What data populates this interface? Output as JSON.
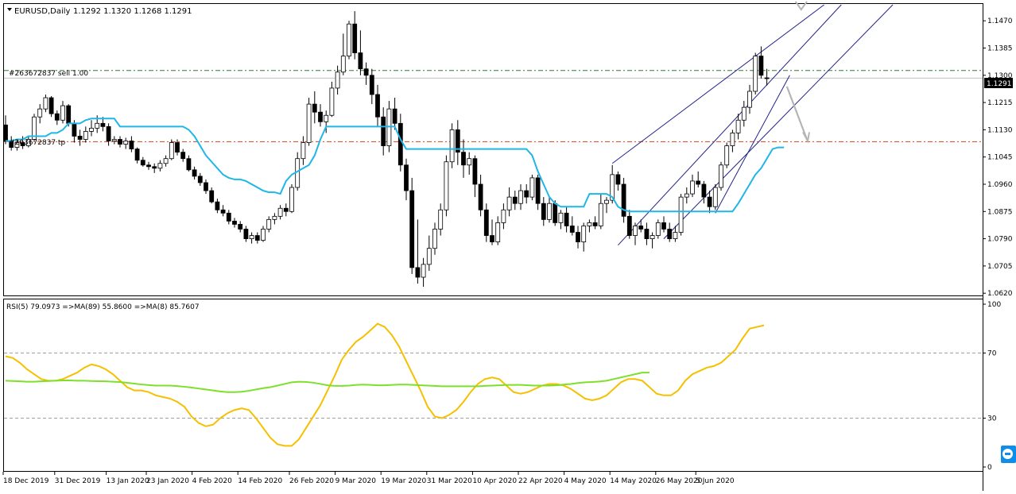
{
  "chart_data": [
    {
      "type": "candlestick",
      "symbol_label": "EURUSD,Daily",
      "ohlc_label": "1.1292 1.1320 1.1268 1.1291",
      "price_axis_ticks": [
        "1.1470",
        "1.1385",
        "1.1300",
        "1.1215",
        "1.1130",
        "1.1045",
        "1.0960",
        "1.0875",
        "1.0790",
        "1.0705",
        "1.0620"
      ],
      "ylim": [
        1.0618,
        1.152
      ],
      "current_price_label": "1.1291",
      "current_price": 1.1291,
      "order_label": "#263672837 sell 1.00",
      "order_price": 1.1315,
      "stop_label": "#263672837 tp",
      "target_price": 1.1093,
      "grid": false,
      "colors": {
        "candle_bull_fill": "#ffffff",
        "candle_bear_fill": "#000000",
        "ma_line": "#1fb6e8",
        "channel": "#23238c",
        "order_line": "#2e7d32",
        "target_line": "#d84315",
        "arrow": "#b5b5b5"
      },
      "candles": [
        [
          1.1145,
          1.1175,
          1.1085,
          1.1095
        ],
        [
          1.1095,
          1.111,
          1.1065,
          1.1075
        ],
        [
          1.1075,
          1.11,
          1.1065,
          1.109
        ],
        [
          1.109,
          1.111,
          1.107,
          1.108
        ],
        [
          1.108,
          1.111,
          1.1075,
          1.11
        ],
        [
          1.11,
          1.118,
          1.1095,
          1.117
        ],
        [
          1.117,
          1.121,
          1.115,
          1.1195
        ],
        [
          1.1195,
          1.124,
          1.1185,
          1.123
        ],
        [
          1.123,
          1.1235,
          1.117,
          1.118
        ],
        [
          1.118,
          1.119,
          1.1145,
          1.116
        ],
        [
          1.116,
          1.122,
          1.115,
          1.1205
        ],
        [
          1.1205,
          1.121,
          1.114,
          1.115
        ],
        [
          1.115,
          1.116,
          1.109,
          1.111
        ],
        [
          1.111,
          1.113,
          1.108,
          1.11
        ],
        [
          1.11,
          1.114,
          1.109,
          1.1125
        ],
        [
          1.1125,
          1.116,
          1.111,
          1.1135
        ],
        [
          1.1135,
          1.1175,
          1.112,
          1.115
        ],
        [
          1.115,
          1.117,
          1.1125,
          1.114
        ],
        [
          1.114,
          1.115,
          1.108,
          1.1095
        ],
        [
          1.1095,
          1.111,
          1.1085,
          1.11
        ],
        [
          1.11,
          1.111,
          1.1075,
          1.1085
        ],
        [
          1.1085,
          1.1105,
          1.107,
          1.1095
        ],
        [
          1.1095,
          1.111,
          1.106,
          1.107
        ],
        [
          1.107,
          1.1075,
          1.1025,
          1.1035
        ],
        [
          1.1035,
          1.1045,
          1.1015,
          1.102
        ],
        [
          1.102,
          1.103,
          1.1005,
          1.1015
        ],
        [
          1.1015,
          1.1025,
          1.0995,
          1.101
        ],
        [
          1.101,
          1.1035,
          1.1,
          1.1025
        ],
        [
          1.1025,
          1.105,
          1.1015,
          1.104
        ],
        [
          1.104,
          1.11,
          1.1035,
          1.109
        ],
        [
          1.109,
          1.11,
          1.105,
          1.106
        ],
        [
          1.106,
          1.107,
          1.103,
          1.104
        ],
        [
          1.104,
          1.105,
          1.1,
          1.1005
        ],
        [
          1.1005,
          1.1015,
          1.0975,
          1.0985
        ],
        [
          1.0985,
          1.0995,
          1.0955,
          1.0965
        ],
        [
          1.0965,
          1.0975,
          1.093,
          1.094
        ],
        [
          1.094,
          1.095,
          1.09,
          1.0905
        ],
        [
          1.0905,
          1.0915,
          1.087,
          1.088
        ],
        [
          1.088,
          1.0895,
          1.086,
          1.087
        ],
        [
          1.087,
          1.088,
          1.0835,
          1.0845
        ],
        [
          1.0845,
          1.0855,
          1.0825,
          1.0835
        ],
        [
          1.0835,
          1.0845,
          1.081,
          1.082
        ],
        [
          1.082,
          1.083,
          1.078,
          1.079
        ],
        [
          1.079,
          1.081,
          1.0775,
          1.08
        ],
        [
          1.08,
          1.081,
          1.0775,
          1.0785
        ],
        [
          1.0785,
          1.083,
          1.078,
          1.082
        ],
        [
          1.082,
          1.086,
          1.081,
          1.085
        ],
        [
          1.085,
          1.087,
          1.0835,
          1.086
        ],
        [
          1.086,
          1.0895,
          1.085,
          1.0885
        ],
        [
          1.0885,
          1.09,
          1.086,
          1.0875
        ],
        [
          1.0875,
          1.096,
          1.087,
          1.095
        ],
        [
          1.095,
          1.106,
          1.094,
          1.104
        ],
        [
          1.104,
          1.111,
          1.102,
          1.109
        ],
        [
          1.109,
          1.123,
          1.108,
          1.121
        ],
        [
          1.121,
          1.125,
          1.115,
          1.1185
        ],
        [
          1.1185,
          1.121,
          1.114,
          1.1155
        ],
        [
          1.1155,
          1.119,
          1.112,
          1.1175
        ],
        [
          1.1175,
          1.128,
          1.117,
          1.126
        ],
        [
          1.126,
          1.133,
          1.124,
          1.131
        ],
        [
          1.131,
          1.143,
          1.13,
          1.136
        ],
        [
          1.136,
          1.147,
          1.135,
          1.146
        ],
        [
          1.146,
          1.15,
          1.135,
          1.137
        ],
        [
          1.137,
          1.144,
          1.13,
          1.132
        ],
        [
          1.132,
          1.134,
          1.127,
          1.13
        ],
        [
          1.13,
          1.132,
          1.121,
          1.124
        ],
        [
          1.124,
          1.127,
          1.114,
          1.117
        ],
        [
          1.117,
          1.12,
          1.105,
          1.108
        ],
        [
          1.108,
          1.122,
          1.106,
          1.1195
        ],
        [
          1.1195,
          1.123,
          1.113,
          1.115
        ],
        [
          1.115,
          1.118,
          1.1,
          1.102
        ],
        [
          1.102,
          1.104,
          1.091,
          1.094
        ],
        [
          1.094,
          1.098,
          1.068,
          1.07
        ],
        [
          1.07,
          1.085,
          1.065,
          1.067
        ],
        [
          1.067,
          1.073,
          1.064,
          1.071
        ],
        [
          1.071,
          1.08,
          1.069,
          1.076
        ],
        [
          1.076,
          1.084,
          1.074,
          1.082
        ],
        [
          1.082,
          1.09,
          1.08,
          1.088
        ],
        [
          1.088,
          1.105,
          1.086,
          1.103
        ],
        [
          1.103,
          1.115,
          1.101,
          1.113
        ],
        [
          1.113,
          1.116,
          1.102,
          1.106
        ],
        [
          1.106,
          1.11,
          1.098,
          1.102
        ],
        [
          1.102,
          1.106,
          1.099,
          1.104
        ],
        [
          1.104,
          1.105,
          1.092,
          1.096
        ],
        [
          1.096,
          1.099,
          1.086,
          1.088
        ],
        [
          1.088,
          1.09,
          1.078,
          1.08
        ],
        [
          1.08,
          1.085,
          1.077,
          1.078
        ],
        [
          1.078,
          1.086,
          1.077,
          1.084
        ],
        [
          1.084,
          1.09,
          1.082,
          1.088
        ],
        [
          1.088,
          1.095,
          1.086,
          1.092
        ],
        [
          1.092,
          1.094,
          1.088,
          1.09
        ],
        [
          1.09,
          1.096,
          1.088,
          1.094
        ],
        [
          1.094,
          1.096,
          1.09,
          1.092
        ],
        [
          1.092,
          1.099,
          1.091,
          1.098
        ],
        [
          1.098,
          1.099,
          1.088,
          1.09
        ],
        [
          1.09,
          1.092,
          1.083,
          1.085
        ],
        [
          1.085,
          1.092,
          1.084,
          1.09
        ],
        [
          1.09,
          1.091,
          1.083,
          1.084
        ],
        [
          1.084,
          1.088,
          1.082,
          1.087
        ],
        [
          1.087,
          1.089,
          1.081,
          1.083
        ],
        [
          1.083,
          1.086,
          1.08,
          1.081
        ],
        [
          1.081,
          1.083,
          1.076,
          1.078
        ],
        [
          1.078,
          1.084,
          1.075,
          1.083
        ],
        [
          1.083,
          1.085,
          1.081,
          1.084
        ],
        [
          1.084,
          1.086,
          1.082,
          1.083
        ],
        [
          1.083,
          1.093,
          1.082,
          1.09
        ],
        [
          1.09,
          1.092,
          1.087,
          1.091
        ],
        [
          1.091,
          1.102,
          1.09,
          1.099
        ],
        [
          1.099,
          1.1,
          1.094,
          1.096
        ],
        [
          1.096,
          1.098,
          1.084,
          1.086
        ],
        [
          1.086,
          1.088,
          1.079,
          1.08
        ],
        [
          1.08,
          1.084,
          1.077,
          1.083
        ],
        [
          1.083,
          1.085,
          1.081,
          1.082
        ],
        [
          1.082,
          1.084,
          1.077,
          1.079
        ],
        [
          1.079,
          1.081,
          1.076,
          1.08
        ],
        [
          1.08,
          1.085,
          1.079,
          1.084
        ],
        [
          1.084,
          1.086,
          1.081,
          1.082
        ],
        [
          1.082,
          1.084,
          1.078,
          1.079
        ],
        [
          1.079,
          1.083,
          1.078,
          1.081
        ],
        [
          1.081,
          1.093,
          1.08,
          1.092
        ],
        [
          1.092,
          1.095,
          1.09,
          1.093
        ],
        [
          1.093,
          1.099,
          1.092,
          1.097
        ],
        [
          1.097,
          1.1,
          1.095,
          1.096
        ],
        [
          1.096,
          1.097,
          1.09,
          1.092
        ],
        [
          1.092,
          1.094,
          1.087,
          1.089
        ],
        [
          1.089,
          1.096,
          1.088,
          1.095
        ],
        [
          1.095,
          1.103,
          1.094,
          1.102
        ],
        [
          1.102,
          1.109,
          1.101,
          1.108
        ],
        [
          1.108,
          1.113,
          1.106,
          1.112
        ],
        [
          1.112,
          1.118,
          1.11,
          1.116
        ],
        [
          1.116,
          1.122,
          1.114,
          1.12
        ],
        [
          1.12,
          1.127,
          1.118,
          1.125
        ],
        [
          1.125,
          1.137,
          1.124,
          1.136
        ],
        [
          1.136,
          1.139,
          1.129,
          1.13
        ],
        [
          1.1292,
          1.132,
          1.1268,
          1.1291
        ]
      ],
      "ma_line_values": [
        1.1095,
        1.1095,
        1.11,
        1.11,
        1.111,
        1.111,
        1.111,
        1.111,
        1.112,
        1.112,
        1.113,
        1.115,
        1.115,
        1.115,
        1.116,
        1.1165,
        1.1165,
        1.1165,
        1.1165,
        1.1165,
        1.114,
        1.114,
        1.114,
        1.114,
        1.114,
        1.114,
        1.114,
        1.114,
        1.114,
        1.114,
        1.114,
        1.114,
        1.113,
        1.111,
        1.108,
        1.105,
        1.103,
        1.101,
        1.099,
        1.098,
        1.0975,
        1.0975,
        1.097,
        1.096,
        1.095,
        1.094,
        1.0935,
        1.0935,
        1.093,
        1.097,
        1.099,
        1.1,
        1.101,
        1.102,
        1.105,
        1.11,
        1.114,
        1.114,
        1.114,
        1.114,
        1.114,
        1.114,
        1.114,
        1.114,
        1.114,
        1.114,
        1.114,
        1.114,
        1.114,
        1.11,
        1.107,
        1.107,
        1.107,
        1.107,
        1.107,
        1.107,
        1.107,
        1.107,
        1.107,
        1.107,
        1.107,
        1.107,
        1.107,
        1.107,
        1.107,
        1.107,
        1.107,
        1.107,
        1.107,
        1.107,
        1.107,
        1.107,
        1.105,
        1.1,
        1.096,
        1.092,
        1.09,
        1.089,
        1.089,
        1.089,
        1.089,
        1.089,
        1.093,
        1.093,
        1.093,
        1.093,
        1.092,
        1.089,
        1.088,
        1.0875,
        1.0875,
        1.0875,
        1.0875,
        1.0875,
        1.0875,
        1.0875,
        1.0875,
        1.0875,
        1.0875,
        1.0875,
        1.0875,
        1.0875,
        1.0875,
        1.0875,
        1.0875,
        1.0875,
        1.0875,
        1.0875,
        1.09,
        1.093,
        1.096,
        1.099,
        1.101,
        1.104,
        1.107,
        1.1075,
        1.1075
      ]
    },
    {
      "type": "line",
      "indicator_label": "RSI(5) 79.0973  =>MA(89) 55.8600  =>MA(8) 85.7607",
      "y_ticks": [
        "100",
        "70",
        "30",
        "0"
      ],
      "ylim": [
        0,
        100
      ],
      "levels": [
        70,
        30
      ],
      "grid": false,
      "series": [
        {
          "color": "#f5c000",
          "values": [
            68,
            67,
            64,
            60,
            57,
            54,
            53,
            53,
            54,
            56,
            58,
            61,
            63,
            62,
            60,
            57,
            53,
            49,
            47,
            47,
            46,
            44,
            43,
            42,
            40,
            37,
            31,
            27,
            25,
            26,
            30,
            33,
            35,
            36,
            35,
            30,
            24,
            18,
            14,
            13,
            13,
            17,
            24,
            31,
            38,
            47,
            56,
            66,
            72,
            77,
            80,
            84,
            88,
            86,
            81,
            74,
            65,
            56,
            47,
            37,
            31,
            30,
            32,
            35,
            40,
            46,
            51,
            54,
            55,
            54,
            50,
            46,
            45,
            46,
            48,
            50,
            51,
            51,
            50,
            48,
            45,
            42,
            41,
            42,
            44,
            48,
            52,
            54,
            54,
            53,
            49,
            45,
            44,
            44,
            47,
            53,
            57,
            59,
            61,
            62,
            64,
            68,
            72,
            79,
            85,
            86,
            87
          ]
        },
        {
          "color": "#7ee02a",
          "values": [
            53,
            52.8,
            52.6,
            52.4,
            52.4,
            52.6,
            52.8,
            53,
            53.2,
            53.2,
            53,
            53,
            52.8,
            52.7,
            52.6,
            52.4,
            52.2,
            51.7,
            51.2,
            50.7,
            50.3,
            50,
            50,
            50,
            49.7,
            49.3,
            48.8,
            48.2,
            47.6,
            47,
            46.4,
            46,
            46,
            46.2,
            46.8,
            47.6,
            48.4,
            49,
            50,
            51,
            52,
            52.4,
            52.2,
            51.8,
            51,
            50.2,
            49.8,
            49.8,
            50,
            50.4,
            50.6,
            50.4,
            50.2,
            50.2,
            50.4,
            50.6,
            50.6,
            50.4,
            50.2,
            50,
            49.8,
            49.6,
            49.6,
            49.6,
            49.6,
            49.6,
            49.6,
            49.8,
            50,
            50.2,
            50.4,
            50.4,
            50.4,
            50.2,
            50,
            50,
            50,
            50.2,
            50.6,
            51,
            51.6,
            52,
            52.2,
            52.5,
            53,
            54,
            55,
            56,
            57,
            58,
            58
          ]
        }
      ]
    }
  ],
  "time_axis": {
    "labels": [
      "18 Dec 2019",
      "31 Dec 2019",
      "13 Jan 2020",
      "23 Jan 2020",
      "4 Feb 2020",
      "14 Feb 2020",
      "26 Feb 2020",
      "9 Mar 2020",
      "19 Mar 2020",
      "31 Mar 2020",
      "10 Apr 2020",
      "22 Apr 2020",
      "4 May 2020",
      "14 May 2020",
      "26 May 2020",
      "5 Jun 2020"
    ]
  }
}
